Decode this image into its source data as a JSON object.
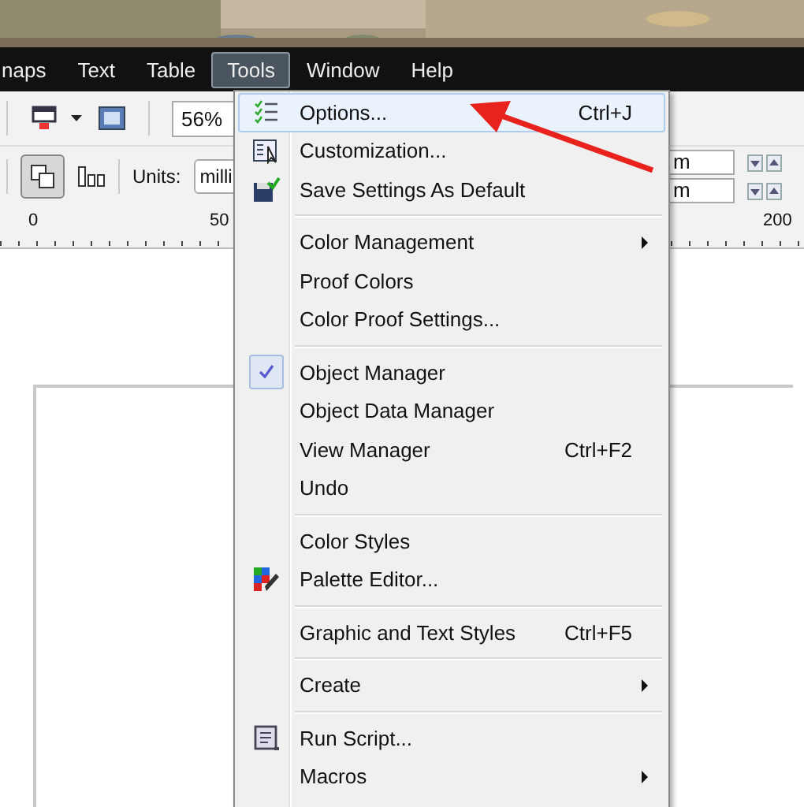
{
  "menubar": [
    {
      "label": "naps",
      "selected": false
    },
    {
      "label": "Text",
      "selected": false
    },
    {
      "label": "Table",
      "selected": false
    },
    {
      "label": "Tools",
      "selected": true
    },
    {
      "label": "Window",
      "selected": false
    },
    {
      "label": "Help",
      "selected": false
    }
  ],
  "toolbar": {
    "zoom": "56%",
    "units_label": "Units:",
    "units_value": "milli",
    "fields": [
      "m",
      "m"
    ]
  },
  "ruler": {
    "ticks": [
      "0",
      "50",
      "200"
    ]
  },
  "menu": [
    {
      "kind": "item",
      "label": "Options...",
      "shortcut": "Ctrl+J",
      "selected": true,
      "checked": false,
      "submenu": false
    },
    {
      "kind": "item",
      "label": "Customization...",
      "selected": false,
      "checked": false,
      "submenu": false
    },
    {
      "kind": "item",
      "label": "Save Settings As Default",
      "selected": false,
      "checked": false,
      "submenu": false
    },
    {
      "kind": "separator"
    },
    {
      "kind": "item",
      "label": "Color Management",
      "selected": false,
      "checked": false,
      "submenu": true
    },
    {
      "kind": "item",
      "label": "Proof Colors",
      "selected": false,
      "checked": false,
      "submenu": false
    },
    {
      "kind": "item",
      "label": "Color Proof Settings...",
      "selected": false,
      "checked": false,
      "submenu": false
    },
    {
      "kind": "separator"
    },
    {
      "kind": "item",
      "label": "Object Manager",
      "selected": false,
      "checked": true,
      "submenu": false
    },
    {
      "kind": "item",
      "label": "Object Data Manager",
      "selected": false,
      "checked": false,
      "submenu": false
    },
    {
      "kind": "item",
      "label": "View Manager",
      "shortcut": "Ctrl+F2",
      "selected": false,
      "checked": false,
      "submenu": false
    },
    {
      "kind": "item",
      "label": "Undo",
      "selected": false,
      "checked": false,
      "submenu": false
    },
    {
      "kind": "separator"
    },
    {
      "kind": "item",
      "label": "Color Styles",
      "selected": false,
      "checked": false,
      "submenu": false
    },
    {
      "kind": "item",
      "label": "Palette Editor...",
      "selected": false,
      "checked": false,
      "submenu": false
    },
    {
      "kind": "separator"
    },
    {
      "kind": "item",
      "label": "Graphic and Text Styles",
      "shortcut": "Ctrl+F5",
      "selected": false,
      "checked": false,
      "submenu": false
    },
    {
      "kind": "separator"
    },
    {
      "kind": "item",
      "label": "Create",
      "selected": false,
      "checked": false,
      "submenu": true
    },
    {
      "kind": "separator"
    },
    {
      "kind": "item",
      "label": "Run Script...",
      "selected": false,
      "checked": false,
      "submenu": false
    },
    {
      "kind": "item",
      "label": "Macros",
      "selected": false,
      "checked": false,
      "submenu": true
    }
  ]
}
